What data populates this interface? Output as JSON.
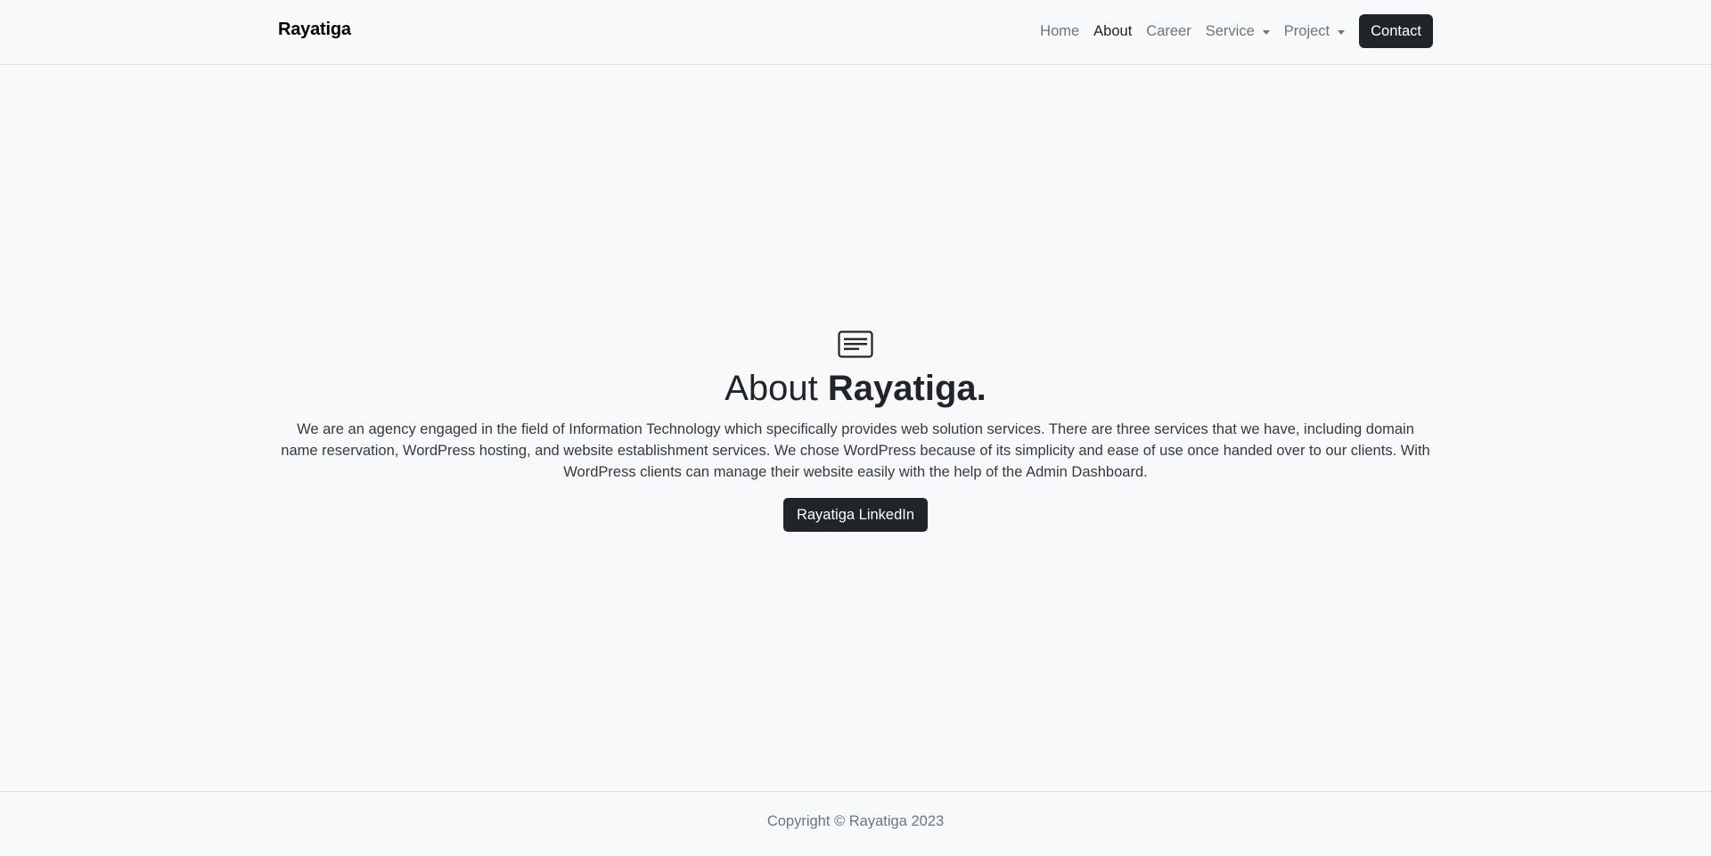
{
  "navbar": {
    "brand": "Rayatiga",
    "links": {
      "home": "Home",
      "about": "About",
      "career": "Career",
      "service": "Service",
      "project": "Project"
    },
    "contact_label": "Contact",
    "active": "About"
  },
  "main": {
    "icon": "card-text-icon",
    "heading_light": "About ",
    "heading_bold": "Rayatiga.",
    "description": "We are an agency engaged in the field of Information Technology which specifically provides web solution services. There are three services that we have, including domain name reservation, WordPress hosting, and website establishment services. We chose WordPress because of its simplicity and ease of use once handed over to our clients. With WordPress clients can manage their website easily with the help of the Admin Dashboard.",
    "linkedin_button": "Rayatiga LinkedIn"
  },
  "footer": {
    "copyright": "Copyright © Rayatiga 2023"
  },
  "colors": {
    "background": "#f8f9fa",
    "dark": "#212529",
    "muted": "#6c757d",
    "border": "#dee2e6"
  }
}
